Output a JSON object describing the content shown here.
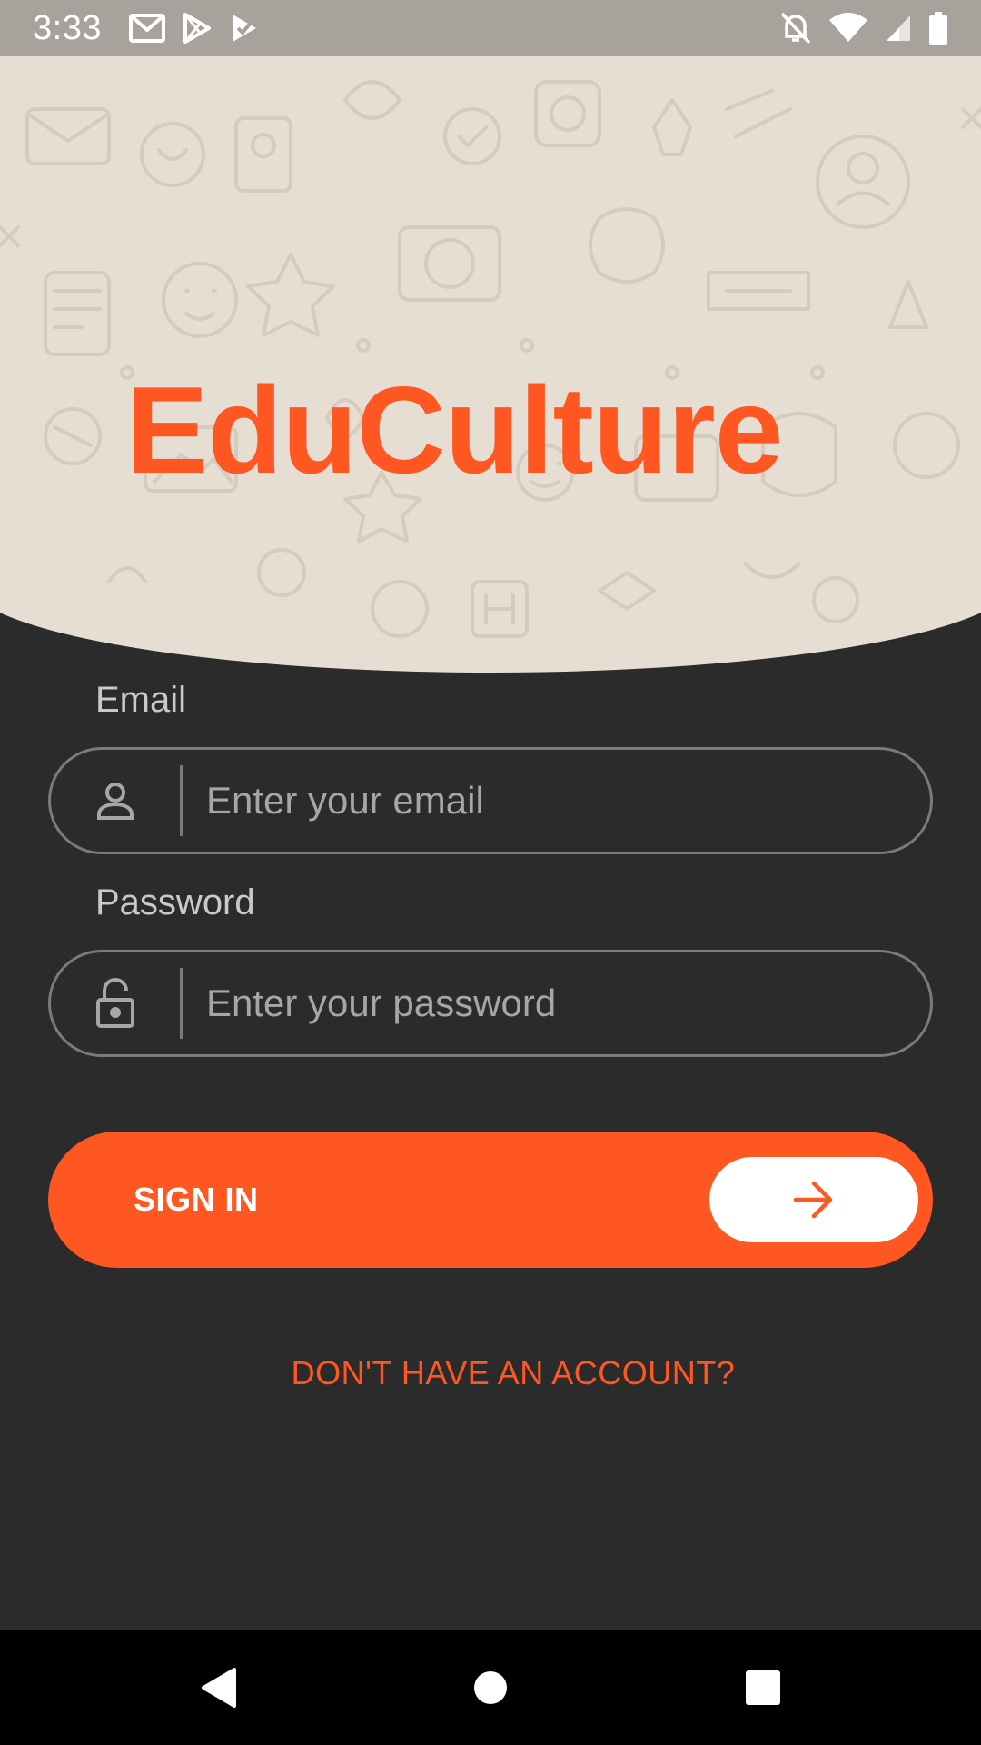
{
  "status_bar": {
    "time": "3:33",
    "left_icons": [
      "gmail-icon",
      "play-store-icon",
      "play-store-check-icon"
    ],
    "right_icons": [
      "notifications-off-icon",
      "wifi-icon",
      "signal-icon",
      "battery-icon"
    ]
  },
  "header": {
    "app_title": "EduCulture",
    "background_color": "#e6ddd3"
  },
  "form": {
    "email": {
      "label": "Email",
      "placeholder": "Enter your email",
      "value": "",
      "icon": "person-icon"
    },
    "password": {
      "label": "Password",
      "placeholder": "Enter your password",
      "value": "",
      "icon": "lock-icon"
    }
  },
  "actions": {
    "sign_in_label": "SIGN IN",
    "sign_in_icon": "arrow-right-icon",
    "signup_link": "DON'T HAVE AN ACCOUNT?"
  },
  "nav_bar": {
    "buttons": [
      "back-icon",
      "home-icon",
      "recents-icon"
    ]
  },
  "colors": {
    "accent": "#ff5722",
    "background": "#2b2b2b",
    "header": "#e6ddd3",
    "field_border": "#7a7a7a"
  }
}
